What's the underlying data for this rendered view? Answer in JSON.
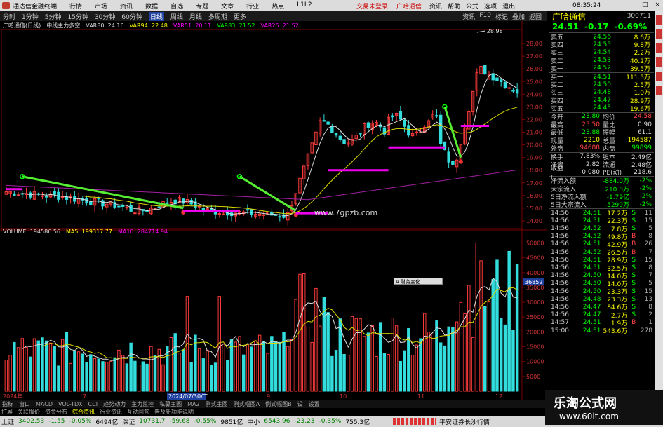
{
  "titlebar": {
    "app_title": "通达信金融终端",
    "menu": [
      "行情",
      "市场",
      "资讯",
      "数据",
      "自选",
      "专题",
      "文章",
      "行业",
      "热点",
      "L1L2"
    ],
    "center_links": [
      "交易未登录",
      "广哈通信"
    ],
    "right_menu": [
      "资讯",
      "帮助",
      "公式",
      "选项",
      "退出"
    ],
    "clock": "08:35:24",
    "win_btns": [
      "一",
      "□",
      "×"
    ]
  },
  "toolbar": {
    "items": [
      "分时",
      "1分钟",
      "5分钟",
      "15分钟",
      "30分钟",
      "60分钟",
      "日线",
      "周线",
      "月线",
      "多周期",
      "更多"
    ],
    "active": "日线",
    "right_items": [
      "资讯",
      "F10",
      "标记",
      "叠加",
      "返回"
    ]
  },
  "chart_header": {
    "stock_label": "广哈通信(日线)",
    "indicator": "中线主力多空",
    "var_labels": [
      {
        "text": "VAR80: 24.16",
        "color": "#dddddd"
      },
      {
        "text": "VAR94: 22.48",
        "color": "#ffff00"
      },
      {
        "text": "VAR51: 20.11",
        "color": "#ff00ff"
      },
      {
        "text": "VAR83: 21.52",
        "color": "#00ff00"
      },
      {
        "text": "VAR25: 21.52",
        "color": "#ff00ff"
      }
    ]
  },
  "vol_header": {
    "labels": [
      {
        "text": "VOLUME: 194586.56",
        "color": "#dddddd"
      },
      {
        "text": "MA5: 199317.77",
        "color": "#ffff00"
      },
      {
        "text": "MA10: 284714.94",
        "color": "#ff00ff"
      }
    ]
  },
  "price_axis": [
    "28.00",
    "27.00",
    "26.00",
    "25.00",
    "24.00",
    "23.00",
    "22.00",
    "21.00",
    "20.00",
    "19.00",
    "18.00",
    "17.00",
    "16.00",
    "15.00",
    "14.00"
  ],
  "vol_axis": [
    "50000",
    "45000",
    "40000",
    "35000",
    "30000",
    "25000",
    "20000",
    "15000",
    "10000",
    "5000"
  ],
  "high_marker": "28.98",
  "vol_marker": "36852",
  "date_axis": [
    "2024年",
    "7",
    "2024/07/30/二",
    "9",
    "10",
    "11",
    "12"
  ],
  "site_mark": "www.7gpzb.com",
  "tooltip": "A 财务变化",
  "bottom_tabs": [
    "指标",
    "窗口",
    "MACD",
    "VOL-TDX",
    "CCI",
    "趋势动力",
    "主力监控",
    "私募主图",
    "MA2",
    "例式主图",
    "例式幅图A",
    "例式幅图B",
    "设",
    "设置"
  ],
  "bottom_tabs2": [
    "扩展",
    "关联报价",
    "资金分布",
    "综合资讯",
    "行业资讯",
    "互动问答",
    "普及新功能说明"
  ],
  "bottom_tabs2_highlight": "综合资讯",
  "status": {
    "items": [
      {
        "text": "上证",
        "cls": ""
      },
      {
        "text": "3402.53",
        "cls": "green"
      },
      {
        "text": "-1.55",
        "cls": "green"
      },
      {
        "text": "-0.05%",
        "cls": "green"
      },
      {
        "text": "6494亿",
        "cls": ""
      },
      {
        "text": "深证",
        "cls": ""
      },
      {
        "text": "10731.7",
        "cls": "green"
      },
      {
        "text": "-59.68",
        "cls": "green"
      },
      {
        "text": "-0.55%",
        "cls": "green"
      },
      {
        "text": "9851亿",
        "cls": ""
      },
      {
        "text": "中小",
        "cls": ""
      },
      {
        "text": "6543.96",
        "cls": "green"
      },
      {
        "text": "-23.23",
        "cls": "green"
      },
      {
        "text": "-0.35%",
        "cls": "green"
      },
      {
        "text": "755.3亿",
        "cls": ""
      }
    ],
    "ticker": "平安证券长沙行情"
  },
  "panel": {
    "stock_name": "广哈通信",
    "stock_code": "300711",
    "price": "24.51",
    "change": "-0.17",
    "change_pct": "-0.69%",
    "asks": [
      {
        "label": "卖五",
        "price": "24.56",
        "vol": "8.6万"
      },
      {
        "label": "卖四",
        "price": "24.55",
        "vol": "9.8万"
      },
      {
        "label": "卖三",
        "price": "24.54",
        "vol": "2.2万"
      },
      {
        "label": "卖二",
        "price": "24.53",
        "vol": "40.2万"
      },
      {
        "label": "卖一",
        "price": "24.52",
        "vol": "39.5万"
      }
    ],
    "bids": [
      {
        "label": "买一",
        "price": "24.51",
        "vol": "111.5万"
      },
      {
        "label": "买二",
        "price": "24.50",
        "vol": "2.5万"
      },
      {
        "label": "买三",
        "price": "24.48",
        "vol": "1.0万"
      },
      {
        "label": "买四",
        "price": "24.47",
        "vol": "28.9万"
      },
      {
        "label": "买五",
        "price": "24.45",
        "vol": "19.6万"
      }
    ],
    "stats": [
      {
        "k1": "今开",
        "v1": "23.80",
        "c1": "g",
        "k2": "均价",
        "v2": "24.58",
        "c2": "r"
      },
      {
        "k1": "最高",
        "v1": "25.50",
        "c1": "r",
        "k2": "量比",
        "v2": "0.90",
        "c2": "w"
      },
      {
        "k1": "最低",
        "v1": "23.88",
        "c1": "g",
        "k2": "振幅",
        "v2": "61.1",
        "c2": "w"
      },
      {
        "k1": "现量",
        "v1": "2210",
        "c1": "y",
        "k2": "总量",
        "v2": "194587",
        "c2": "y"
      },
      {
        "k1": "外盘",
        "v1": "94688",
        "c1": "r",
        "k2": "内盘",
        "v2": "99899",
        "c2": "g"
      }
    ],
    "stats2": [
      {
        "k1": "换手",
        "v1": "7.83%",
        "c1": "w",
        "k2": "股本",
        "v2": "2.49亿",
        "c2": "w"
      },
      {
        "k1": "净资",
        "v1": "2.82",
        "c1": "w",
        "k2": "流通",
        "v2": "2.48亿",
        "c2": "w"
      },
      {
        "k1": "收益(三)",
        "v1": "0.080",
        "c1": "w",
        "k2": "PE(动)",
        "v2": "218.6",
        "c2": "w"
      }
    ],
    "flows": [
      {
        "label": "净流入额",
        "value": "-884.0万",
        "pct": "-2%"
      },
      {
        "label": "大宗流入",
        "value": "210.8万",
        "pct": "-2%"
      },
      {
        "label": "5日净流入额",
        "value": "-1.79亿",
        "pct": "-2%"
      },
      {
        "label": "5日大宗流入",
        "value": "-5299万",
        "pct": "-2%"
      }
    ],
    "ticks": [
      {
        "t": "14:56",
        "p": "24.51",
        "v": "17.2万",
        "s": "S",
        "n": "11"
      },
      {
        "t": "14:56",
        "p": "24.51",
        "v": "22.3万",
        "s": "S",
        "n": "15"
      },
      {
        "t": "14:56",
        "p": "24.52",
        "v": "7.8万",
        "s": "S",
        "n": "5"
      },
      {
        "t": "14:56",
        "p": "24.52",
        "v": "49.8万",
        "s": "B",
        "n": "8"
      },
      {
        "t": "14:56",
        "p": "24.51",
        "v": "42.9万",
        "s": "B",
        "n": "26"
      },
      {
        "t": "14:56",
        "p": "24.52",
        "v": "26.5万",
        "s": "B",
        "n": "7"
      },
      {
        "t": "14:56",
        "p": "24.51",
        "v": "28.9万",
        "s": "S",
        "n": "15"
      },
      {
        "t": "14:56",
        "p": "24.51",
        "v": "32.5万",
        "s": "S",
        "n": "8"
      },
      {
        "t": "14:56",
        "p": "24.50",
        "v": "14.0万",
        "s": "S",
        "n": "7"
      },
      {
        "t": "14:56",
        "p": "24.50",
        "v": "14.0万",
        "s": "S",
        "n": "5"
      },
      {
        "t": "14:56",
        "p": "24.50",
        "v": "23.3万",
        "s": "S",
        "n": "15"
      },
      {
        "t": "14:56",
        "p": "24.48",
        "v": "23.3万",
        "s": "S",
        "n": "13"
      },
      {
        "t": "14:56",
        "p": "24.47",
        "v": "84.6万",
        "s": "S",
        "n": "8"
      },
      {
        "t": "14:56",
        "p": "24.47",
        "v": "2.7万",
        "s": "S",
        "n": "2"
      },
      {
        "t": "14:57",
        "p": "24.51",
        "v": "1.9万",
        "s": "B",
        "n": "1"
      },
      {
        "t": "15:00",
        "p": "24.51",
        "v": "543.6万",
        "s": "",
        "n": "278"
      }
    ]
  },
  "watermark": {
    "line1": "乐淘公式网",
    "line2": "www.60lt.com"
  },
  "colors": {
    "up": "#ff3b3b",
    "down": "#33dddd",
    "green_line": "#55ee33",
    "magenta_line": "#ee00ee",
    "white_ma": "#dddddd",
    "yellow_ma": "#dddd00",
    "grid": "#7a0000"
  }
}
